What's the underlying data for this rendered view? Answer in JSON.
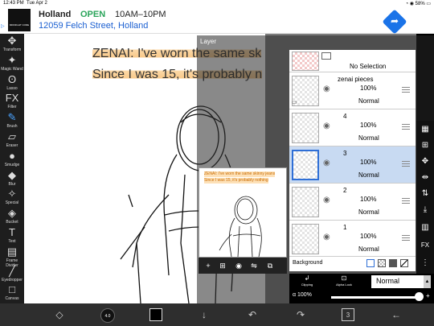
{
  "status": {
    "time": "12:43 PM",
    "date": "Tue Apr 2",
    "battery": "58%"
  },
  "ad": {
    "logo_text": "MIDNIGHT CORE",
    "title": "Holland",
    "open_label": "OPEN",
    "hours": "10AM–10PM",
    "address": "12059 Felch Street, Holland",
    "info_icon": "▷"
  },
  "tools": [
    {
      "name": "transform",
      "label": "Transform",
      "icon": "✥"
    },
    {
      "name": "magic-wand",
      "label": "Magic Wand",
      "icon": "✦"
    },
    {
      "name": "lasso",
      "label": "Lasso",
      "icon": "ʘ"
    },
    {
      "name": "filter",
      "label": "Filter",
      "icon": "FX"
    },
    {
      "name": "brush",
      "label": "Brush",
      "icon": "✎"
    },
    {
      "name": "eraser",
      "label": "Eraser",
      "icon": "▱"
    },
    {
      "name": "smudge",
      "label": "Smudge",
      "icon": "●"
    },
    {
      "name": "blur",
      "label": "Blur",
      "icon": "◆"
    },
    {
      "name": "special",
      "label": "Special",
      "icon": "✧"
    },
    {
      "name": "bucket",
      "label": "Bucket",
      "icon": "◈"
    },
    {
      "name": "text",
      "label": "Text",
      "icon": "T"
    },
    {
      "name": "frame-divider",
      "label": "Frame Divider",
      "icon": "▤"
    },
    {
      "name": "eyedropper",
      "label": "Eyedropper",
      "icon": "╱"
    },
    {
      "name": "canvas",
      "label": "Canvas",
      "icon": "□"
    }
  ],
  "canvas_text": {
    "line1": "ZENAI: I've worn the same sk",
    "line2": "Since I was 15, it's probably n"
  },
  "preview_text": {
    "line1": "ZENAI: I've worn the same skinny jeans",
    "line2": "Since I was 15, it's probably nothing"
  },
  "layer_panel": {
    "title": "Layer",
    "no_selection": "No Selection",
    "folder_name": "zenai pieces",
    "rows": [
      {
        "num": "",
        "name": "zenai pieces",
        "opacity": "100%",
        "mode": "Normal"
      },
      {
        "num": "4",
        "opacity": "100%",
        "mode": "Normal"
      },
      {
        "num": "3",
        "opacity": "100%",
        "mode": "Normal"
      },
      {
        "num": "2",
        "opacity": "100%",
        "mode": "Normal"
      },
      {
        "num": "1",
        "opacity": "100%",
        "mode": "Normal"
      }
    ],
    "background_label": "Background",
    "clipping_label": "Clipping",
    "alpha_lock_label": "Alpha Lock",
    "blend_mode": "Normal",
    "alpha_label": "α 100%",
    "alpha_value": 1.0
  },
  "bottom": {
    "pages_badge": "3",
    "brush_size": "4.0"
  }
}
